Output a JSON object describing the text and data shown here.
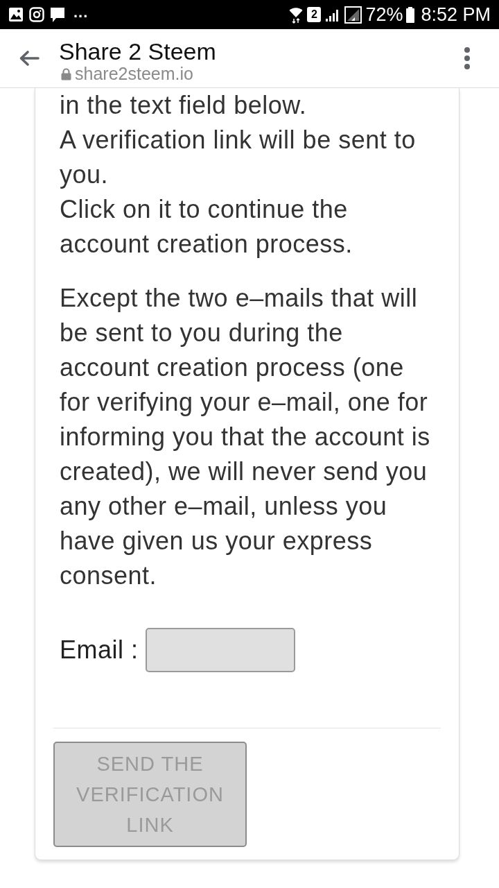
{
  "status_bar": {
    "notification_overflow": "...",
    "sim_slot": "2",
    "battery_percent": "72%",
    "time": "8:52 PM"
  },
  "toolbar": {
    "title": "Share 2 Steem",
    "url": "share2steem.io",
    "secure": true
  },
  "card": {
    "intro_lines": [
      "in the text field below.",
      "A verification link will be sent to you.",
      "Click on it to continue the account creation process."
    ],
    "notice": "Except the two e–mails that will be sent to you during the account creation process (one for verifying your e–mail, one for informing you that the account is created), we will never send you any other e–mail, unless you have given us your express consent.",
    "email_field": {
      "label": "Email :"
    },
    "submit_button": {
      "label": "SEND THE VERIFICATION LINK",
      "disabled": true
    }
  }
}
